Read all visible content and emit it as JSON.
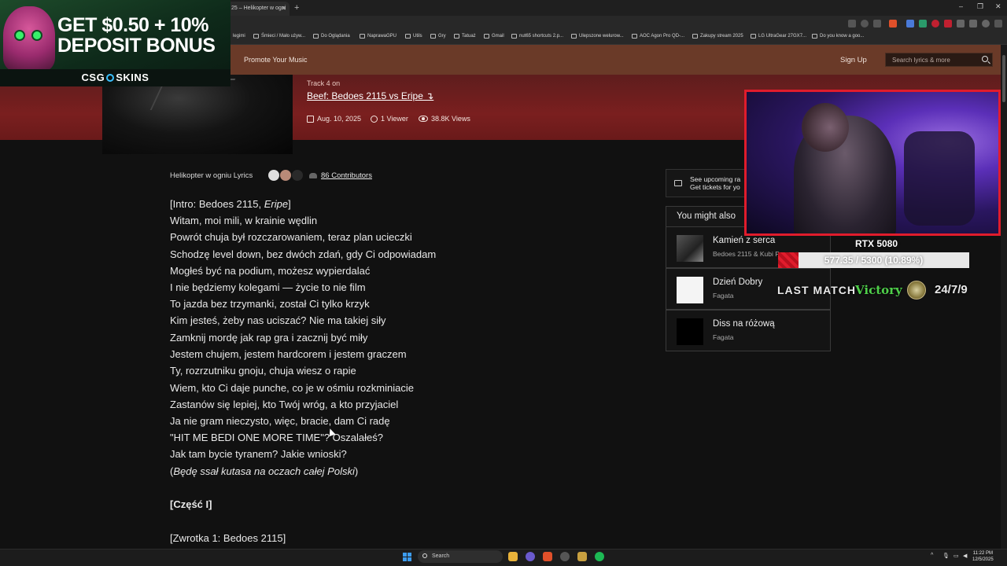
{
  "browser": {
    "tab_title": "25 – Helikopter w ogni",
    "new_tab": "+",
    "window_controls": [
      "–",
      "❐",
      "✕"
    ],
    "bookmarks": [
      "legimi",
      "Śmieci / Mało używ...",
      "Do Oglądania",
      "NaprawaGPU",
      "Utils",
      "Gry",
      "Tatuaż",
      "Gmail",
      "nut65 shortcuts 2.p...",
      "Ulepszone welurow...",
      "AOC Agon Pro QD-...",
      "Zakupy stream 2025",
      "LG UltraGear 27GX7...",
      "Do you know a goo..."
    ]
  },
  "ad": {
    "line1": "GET $0.50 + 10%",
    "line2": "DEPOSIT BONUS",
    "brand_left": "CSG",
    "brand_right": "SKINS"
  },
  "header": {
    "promote": "Promote Your Music",
    "signup": "Sign Up",
    "search_placeholder": "Search lyrics & more"
  },
  "song": {
    "track_label": "Track 4 on",
    "album": "Beef: Bedoes 2115 vs Eripe ↴",
    "date": "Aug. 10, 2025",
    "viewers": "1 Viewer",
    "views": "38.8K Views",
    "lyrics_title": "Helikopter w ogniu Lyrics",
    "contributors": "86 Contributors"
  },
  "lyrics": {
    "intro_prefix": "[Intro: Bedoes 2115, ",
    "intro_italic": "Eripe",
    "intro_suffix": "]",
    "lines": [
      "Witam, moi mili, w krainie wędlin",
      "Powrót chuja był rozczarowaniem, teraz plan ucieczki",
      "Schodzę level down, bez dwóch zdań, gdy Ci odpowiadam",
      "Mogłeś być na podium, możesz wypierdalać",
      "I nie będziemy kolegami — życie to nie film",
      "To jazda bez trzymanki, został Ci tylko krzyk",
      "Kim jesteś, żeby nas uciszać? Nie ma takiej siły",
      "Zamknij mordę jak rap gra i zacznij być miły",
      "Jestem chujem, jestem hardcorem i jestem graczem",
      "Ty, rozrzutniku gnoju, chuja wiesz o rapie",
      "Wiem, kto Ci daje punche, co je w ośmiu rozkminiacie",
      "Zastanów się lepiej, kto Twój wróg, a kto przyjaciel",
      "Ja nie gram nieczysto, więc, bracie, dam Ci radę",
      "\"HIT ME BEDI ONE MORE TIME\"? Oszalałeś?",
      "Jak tam bycie tyranem? Jakie wnioski?"
    ],
    "italic_line_open": "(",
    "italic_line": "Będę ssał kutasa na oczach całej Polski",
    "italic_line_close": ")",
    "section": "[Część I]",
    "verse": "[Zwrotka 1: Bedoes 2115]"
  },
  "sidebar": {
    "tickets_line1": "See upcoming ra",
    "tickets_line2": "Get tickets for yo",
    "might_also": "You might also",
    "songs": [
      {
        "title": "Kamień z serca",
        "artist": "Bedoes 2115 & Kubi P..."
      },
      {
        "title": "Dzień Dobry",
        "artist": "Fagata"
      },
      {
        "title": "Diss na różową",
        "artist": "Fagata"
      }
    ]
  },
  "stream_overlay": {
    "gpu": "RTX 5080",
    "progress_text": "577.35 / 5300 (10.89%)",
    "progress_fraction": 0.1089,
    "last_match_label": "LAST MATCH",
    "last_match_result": "Victory",
    "uptime": "24/7/9",
    "accent_color": "#e01c2c",
    "victory_color": "#4fd04a"
  },
  "taskbar": {
    "search": "Search",
    "time": "11:22 PM",
    "date": "12/5/2025"
  }
}
